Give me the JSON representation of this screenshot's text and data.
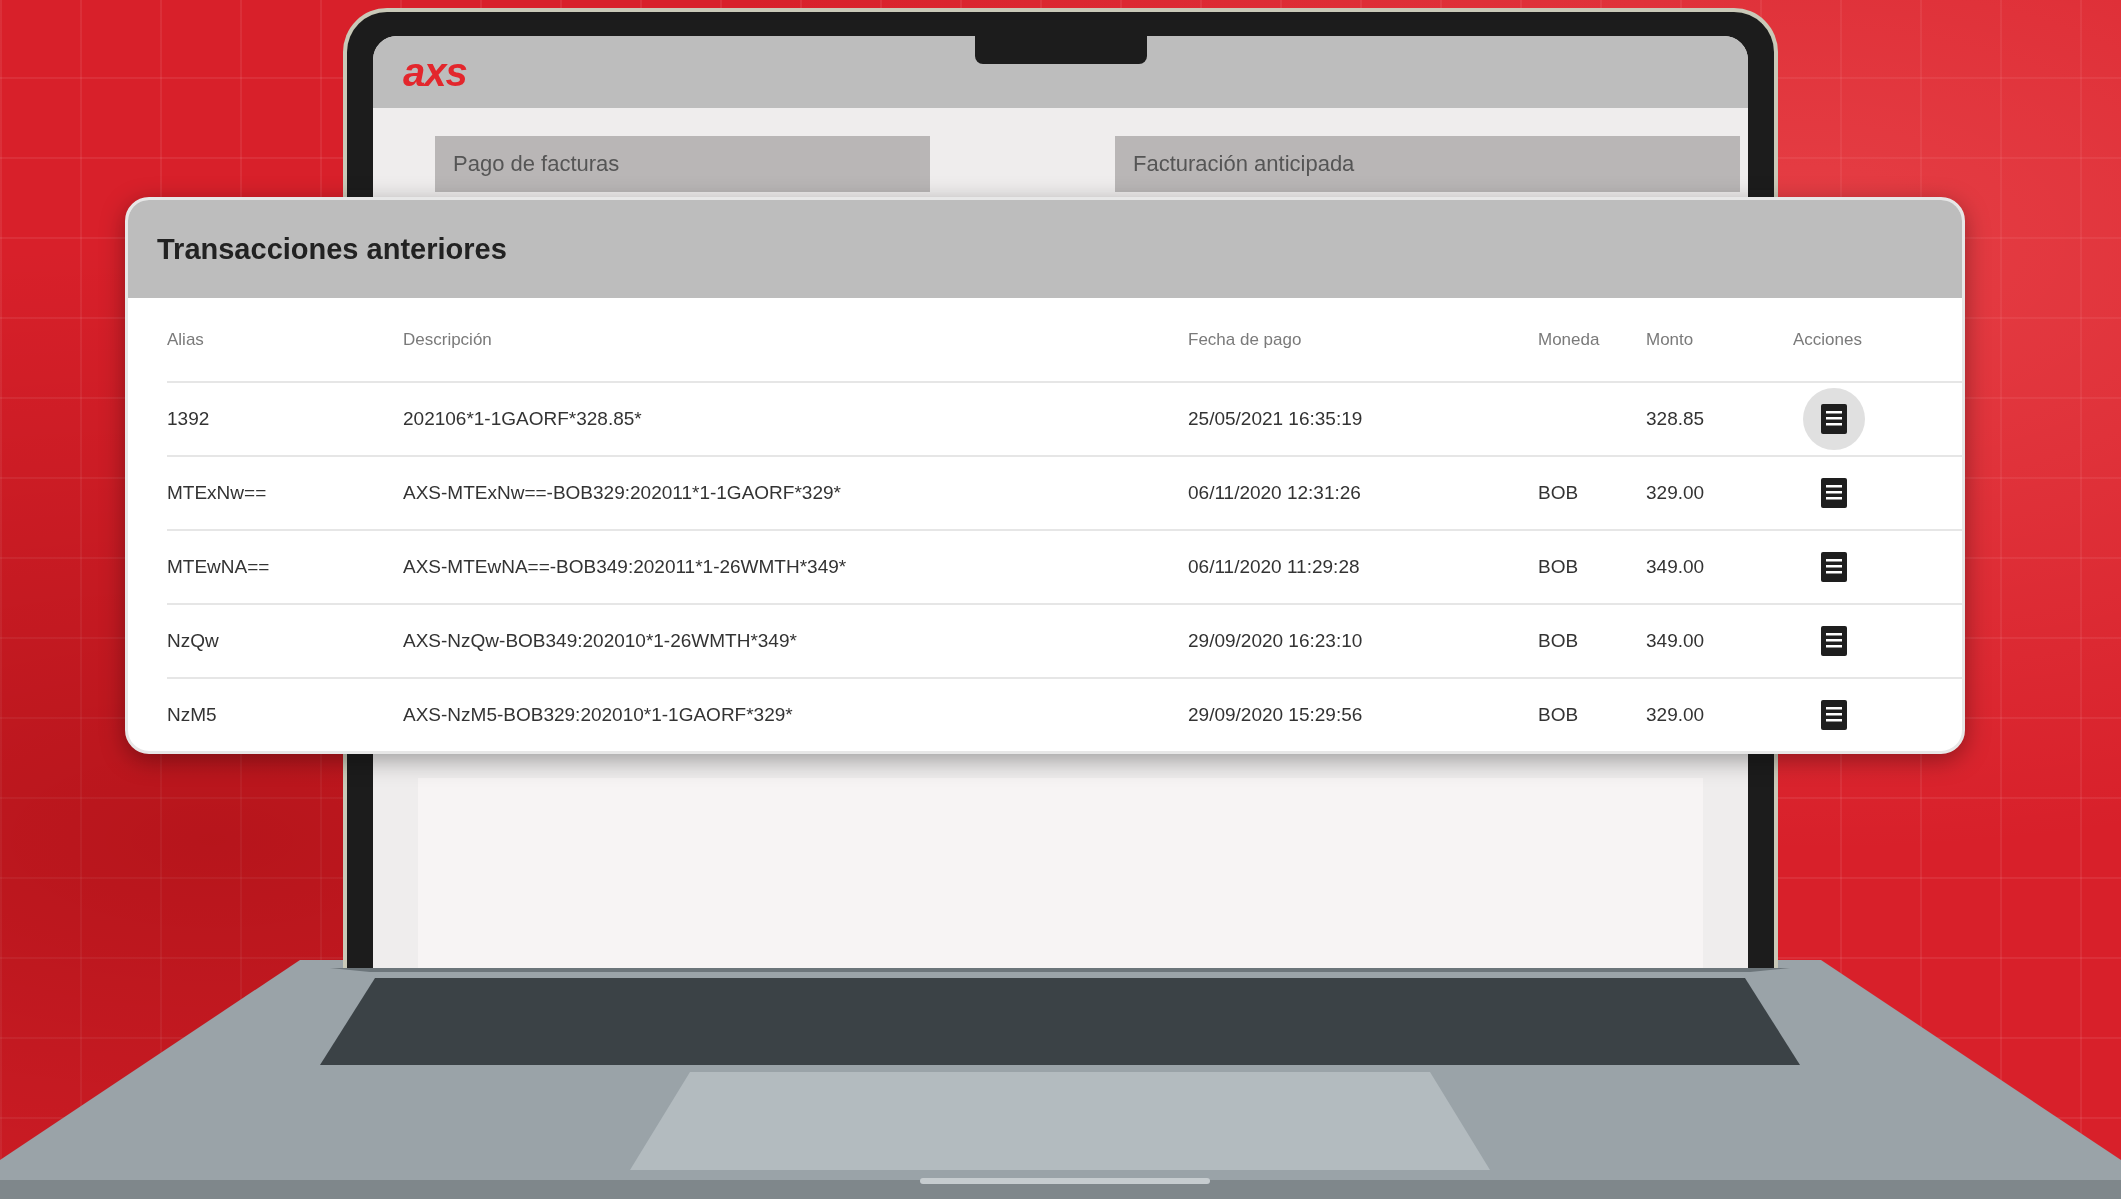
{
  "laptop_screen": {
    "logo": "axs",
    "cards": [
      "Pago de facturas",
      "Facturación anticipada"
    ]
  },
  "transactions": {
    "title": "Transacciones anteriores",
    "columns": [
      "Alias",
      "Descripción",
      "Fecha de pago",
      "Moneda",
      "Monto",
      "Acciones"
    ],
    "rows": [
      {
        "alias": "1392",
        "description": "202106*1-1GAORF*328.85*",
        "date": "25/05/2021 16:35:19",
        "currency": "",
        "amount": "328.85",
        "action_highlighted": true
      },
      {
        "alias": "MTExNw==",
        "description": "AXS-MTExNw==-BOB329:202011*1-1GAORF*329*",
        "date": "06/11/2020 12:31:26",
        "currency": "BOB",
        "amount": "329.00",
        "action_highlighted": false
      },
      {
        "alias": "MTEwNA==",
        "description": "AXS-MTEwNA==-BOB349:202011*1-26WMTH*349*",
        "date": "06/11/2020 11:29:28",
        "currency": "BOB",
        "amount": "349.00",
        "action_highlighted": false
      },
      {
        "alias": "NzQw",
        "description": "AXS-NzQw-BOB349:202010*1-26WMTH*349*",
        "date": "29/09/2020 16:23:10",
        "currency": "BOB",
        "amount": "349.00",
        "action_highlighted": false
      },
      {
        "alias": "NzM5",
        "description": "AXS-NzM5-BOB329:202010*1-1GAORF*329*",
        "date": "29/09/2020 15:29:56",
        "currency": "BOB",
        "amount": "329.00",
        "action_highlighted": false
      }
    ]
  }
}
